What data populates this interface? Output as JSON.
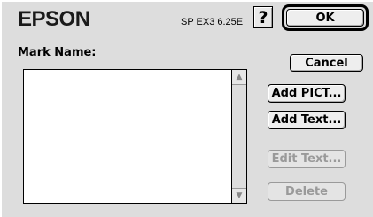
{
  "dialog": {
    "brand": "EPSON",
    "version": "SP EX3 6.25E",
    "help_label": "?",
    "mark_name_label": "Mark Name:"
  },
  "buttons": {
    "ok": "OK",
    "cancel": "Cancel",
    "add_pict": "Add PICT...",
    "add_text": "Add Text...",
    "edit_text": "Edit Text...",
    "delete": "Delete"
  },
  "list": {
    "items": []
  },
  "icons": {
    "scroll_up": "scroll-up-arrow-icon",
    "scroll_down": "scroll-down-arrow-icon",
    "help": "help-icon"
  },
  "colors": {
    "dialog_bg": "#dddddd",
    "disabled_text": "#9a9a9a"
  }
}
